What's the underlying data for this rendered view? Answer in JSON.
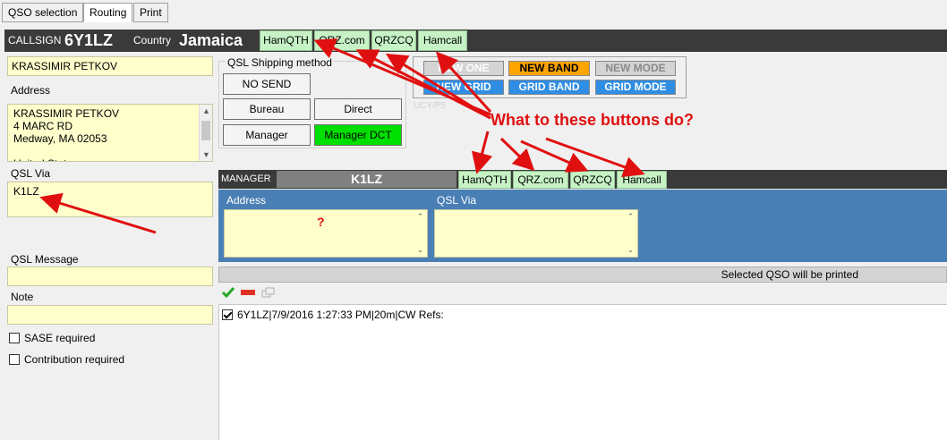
{
  "tabs": [
    {
      "label": "QSO selection"
    },
    {
      "label": "Routing"
    },
    {
      "label": "Print"
    }
  ],
  "header": {
    "callsign_label": "CALLSIGN",
    "callsign": "6Y1LZ",
    "country_label": "Country",
    "country": "Jamaica",
    "lookup_buttons": [
      "HamQTH",
      "QRZ.com",
      "QRZCQ",
      "Hamcall"
    ]
  },
  "left": {
    "name_value": "KRASSIMIR PETKOV",
    "address_label": "Address",
    "address_value": "KRASSIMIR PETKOV\n4 MARC RD\nMedway, MA 02053\n\nUnited States",
    "qsl_via_label": "QSL Via",
    "qsl_via_value": "K1LZ",
    "qsl_message_label": "QSL Message",
    "qsl_message_value": "",
    "note_label": "Note",
    "note_value": "",
    "sase_label": "SASE required",
    "contribution_label": "Contribution required"
  },
  "shipping": {
    "label": "QSL Shipping method",
    "no_send": "NO SEND",
    "bureau": "Bureau",
    "direct": "Direct",
    "manager": "Manager",
    "manager_dct": "Manager DCT"
  },
  "modes": {
    "new_one": "NEW ONE",
    "new_band": "NEW BAND",
    "new_mode": "NEW MODE",
    "new_grid": "NEW GRID",
    "grid_band": "GRID BAND",
    "grid_mode": "GRID MODE",
    "hidden_text": "UCY/P5"
  },
  "manager": {
    "label": "MANAGER",
    "callsign": "K1LZ",
    "lookup_buttons": [
      "HamQTH",
      "QRZ.com",
      "QRZCQ",
      "Hamcall"
    ],
    "address_label": "Address",
    "address_value": "",
    "qsl_via_label": "QSL Via",
    "qsl_via_value": "",
    "unknown_marker": "?"
  },
  "print_bar": {
    "text": "Selected QSO will be printed"
  },
  "qso_list": [
    {
      "text": "6Y1LZ|7/9/2016 1:27:33 PM|20m|CW Refs:",
      "checked": true
    }
  ],
  "annotation": {
    "text": "What to these buttons do?"
  },
  "colors": {
    "dark_bar": "#3a3a3a",
    "lookup_green": "#c6f2c6",
    "field_yellow": "#ffffcc",
    "manager_panel_blue": "#4a7fb5",
    "manager_dct_green": "#00e000",
    "new_band_orange": "#ffa500",
    "grid_blue": "#2f8de4",
    "arrow_red": "#e01010"
  }
}
